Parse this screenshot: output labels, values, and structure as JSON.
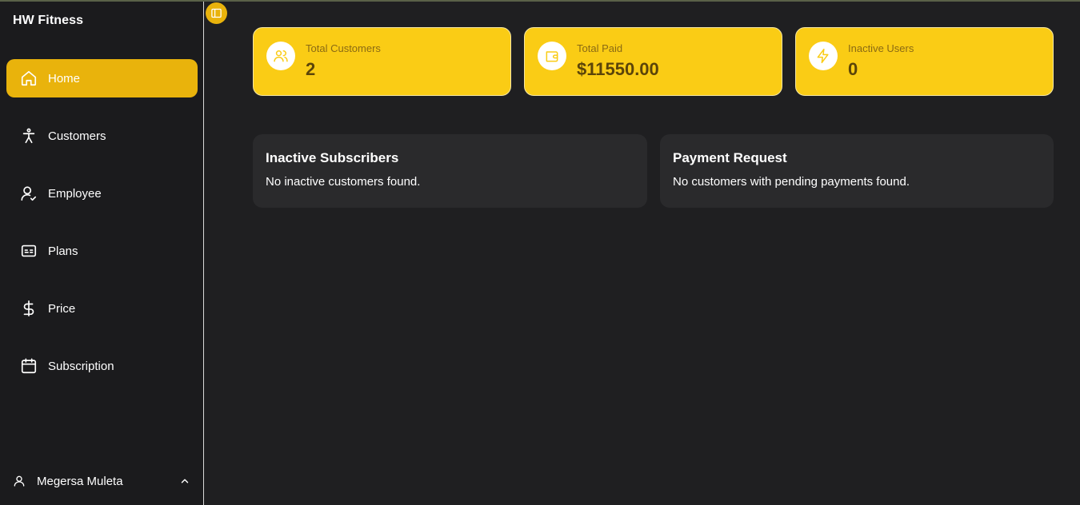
{
  "sidebar": {
    "brand": "HW Fitness",
    "items": [
      {
        "label": "Home",
        "icon": "home-icon",
        "active": true
      },
      {
        "label": "Customers",
        "icon": "person-icon",
        "active": false
      },
      {
        "label": "Employee",
        "icon": "user-check-icon",
        "active": false
      },
      {
        "label": "Plans",
        "icon": "id-card-icon",
        "active": false
      },
      {
        "label": "Price",
        "icon": "dollar-icon",
        "active": false
      },
      {
        "label": "Subscription",
        "icon": "calendar-icon",
        "active": false
      }
    ],
    "user": {
      "name": "Megersa Muleta",
      "icon": "user-icon"
    }
  },
  "stats": [
    {
      "label": "Total Customers",
      "value": "2",
      "icon": "users-icon"
    },
    {
      "label": "Total Paid",
      "value": "$11550.00",
      "icon": "wallet-icon"
    },
    {
      "label": "Inactive Users",
      "value": "0",
      "icon": "bolt-icon"
    }
  ],
  "panels": {
    "inactive": {
      "title": "Inactive Subscribers",
      "text": "No inactive customers found."
    },
    "payment": {
      "title": "Payment Request",
      "text": "No customers with pending payments found."
    }
  },
  "colors": {
    "accent": "#facc15",
    "accent_active": "#e9b30c",
    "background": "#1f1f21",
    "sidebar": "#1b1b1d",
    "panel": "#2a2a2c"
  }
}
